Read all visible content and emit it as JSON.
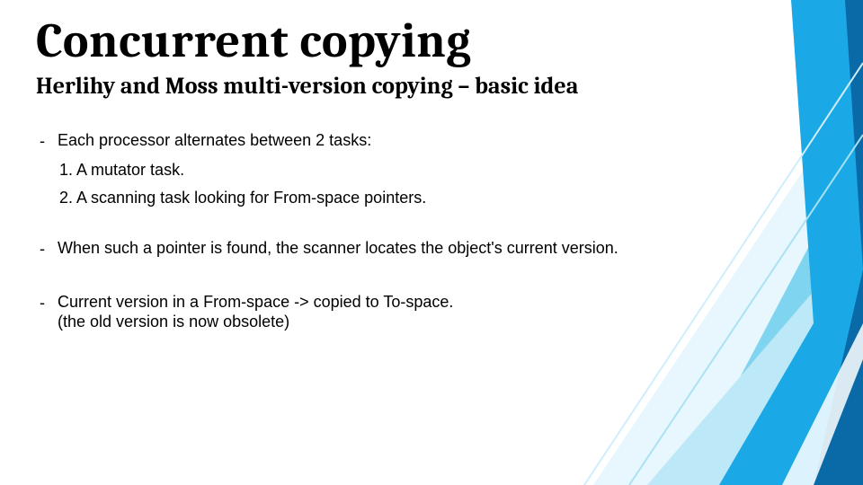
{
  "title": "Concurrent copying",
  "subtitle": "Herlihy and Moss multi-version copying – basic idea",
  "bullets": [
    {
      "text": "Each processor alternates between 2 tasks:",
      "sub": [
        "1. A mutator task.",
        "2. A scanning task looking for From-space pointers."
      ]
    },
    {
      "text": "When such a pointer is found, the scanner locates the object's current version.",
      "sub": []
    },
    {
      "text": "Current version in a From-space -> copied to To-space.\n(the old version is now obsolete)",
      "sub": []
    }
  ],
  "dash": "-"
}
